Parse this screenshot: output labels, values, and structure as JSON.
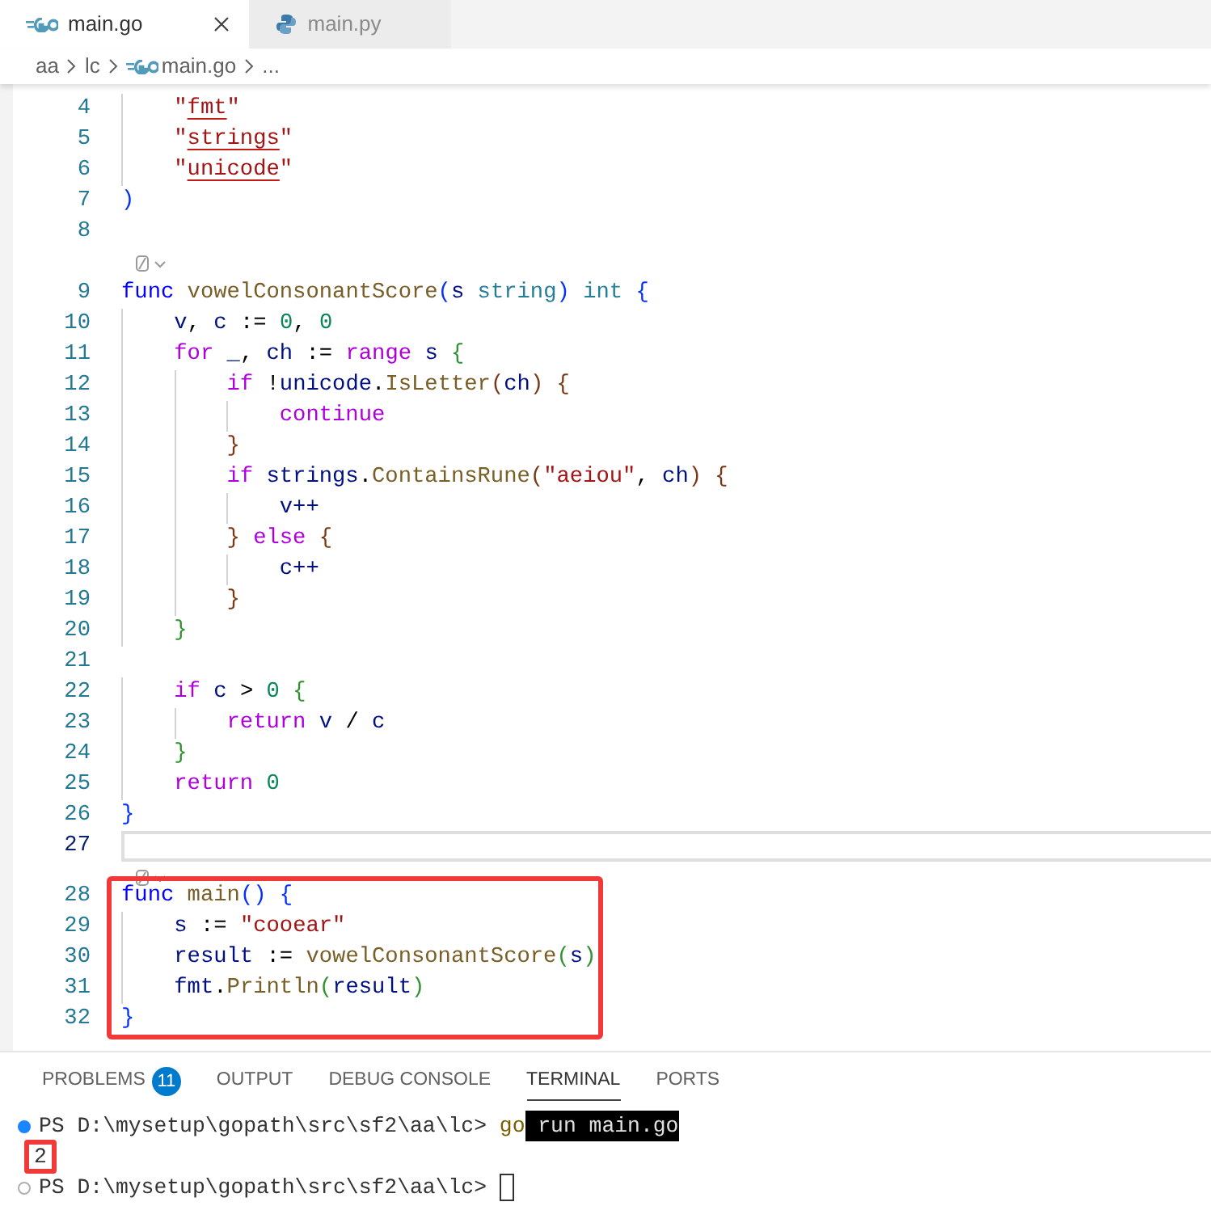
{
  "tabs": [
    {
      "label": "main.go",
      "kind": "go",
      "selected": true,
      "closable": true
    },
    {
      "label": "main.py",
      "kind": "python",
      "selected": false,
      "closable": false
    }
  ],
  "breadcrumbs": [
    {
      "label": "aa",
      "kind": "folder"
    },
    {
      "label": "lc",
      "kind": "folder"
    },
    {
      "label": "main.go",
      "kind": "go"
    },
    {
      "label": "...",
      "kind": "symbol"
    }
  ],
  "editor": {
    "lines": [
      {
        "kind": "code",
        "number": "4",
        "current": false,
        "tokens": [
          {
            "text": "    \"",
            "kind": "string"
          },
          {
            "text": "fmt",
            "kind": "string-flagged"
          },
          {
            "text": "\"",
            "kind": "string"
          }
        ]
      },
      {
        "kind": "code",
        "number": "5",
        "current": false,
        "tokens": [
          {
            "text": "    \"",
            "kind": "string"
          },
          {
            "text": "strings",
            "kind": "string-flagged"
          },
          {
            "text": "\"",
            "kind": "string"
          }
        ]
      },
      {
        "kind": "code",
        "number": "6",
        "current": false,
        "tokens": [
          {
            "text": "    \"",
            "kind": "string"
          },
          {
            "text": "unicode",
            "kind": "string-flagged"
          },
          {
            "text": "\"",
            "kind": "string"
          }
        ]
      },
      {
        "kind": "code",
        "number": "7",
        "current": false,
        "tokens": [
          {
            "text": ")",
            "kind": "bracket1"
          }
        ]
      },
      {
        "kind": "code",
        "number": "8",
        "current": false
      },
      {
        "kind": "codelens"
      },
      {
        "kind": "code",
        "number": "9",
        "current": false,
        "tokens": [
          {
            "text": "func ",
            "kind": "keyword"
          },
          {
            "text": "vowelConsonantScore",
            "kind": "function"
          },
          {
            "text": "(",
            "kind": "bracket1"
          },
          {
            "text": "s ",
            "kind": "variable"
          },
          {
            "text": "string",
            "kind": "type"
          },
          {
            "text": ") ",
            "kind": "bracket1"
          },
          {
            "text": "int ",
            "kind": "type"
          },
          {
            "text": "{",
            "kind": "bracket1"
          }
        ]
      },
      {
        "kind": "code",
        "number": "10",
        "current": false,
        "tokens": [
          {
            "text": "    v",
            "kind": "variable"
          },
          {
            "text": ", ",
            "kind": "plain"
          },
          {
            "text": "c",
            "kind": "variable"
          },
          {
            "text": " := ",
            "kind": "plain"
          },
          {
            "text": "0",
            "kind": "number"
          },
          {
            "text": ", ",
            "kind": "plain"
          },
          {
            "text": "0",
            "kind": "number"
          }
        ]
      },
      {
        "kind": "code",
        "number": "11",
        "current": false,
        "tokens": [
          {
            "text": "    for ",
            "kind": "control"
          },
          {
            "text": "_",
            "kind": "variable"
          },
          {
            "text": ", ",
            "kind": "plain"
          },
          {
            "text": "ch",
            "kind": "variable"
          },
          {
            "text": " := ",
            "kind": "plain"
          },
          {
            "text": "range ",
            "kind": "control"
          },
          {
            "text": "s ",
            "kind": "variable"
          },
          {
            "text": "{",
            "kind": "bracket2"
          }
        ]
      },
      {
        "kind": "code",
        "number": "12",
        "current": false,
        "tokens": [
          {
            "text": "        if",
            "kind": "control"
          },
          {
            "text": " !",
            "kind": "plain"
          },
          {
            "text": "unicode",
            "kind": "variable"
          },
          {
            "text": ".",
            "kind": "plain"
          },
          {
            "text": "IsLetter",
            "kind": "function"
          },
          {
            "text": "(",
            "kind": "bracket3"
          },
          {
            "text": "ch",
            "kind": "variable"
          },
          {
            "text": ") {",
            "kind": "bracket3"
          }
        ]
      },
      {
        "kind": "code",
        "number": "13",
        "current": false,
        "tokens": [
          {
            "text": "            continue",
            "kind": "control"
          }
        ]
      },
      {
        "kind": "code",
        "number": "14",
        "current": false,
        "tokens": [
          {
            "text": "        }",
            "kind": "bracket3"
          }
        ]
      },
      {
        "kind": "code",
        "number": "15",
        "current": false,
        "tokens": [
          {
            "text": "        if ",
            "kind": "control"
          },
          {
            "text": "strings",
            "kind": "variable"
          },
          {
            "text": ".",
            "kind": "plain"
          },
          {
            "text": "ContainsRune",
            "kind": "function"
          },
          {
            "text": "(",
            "kind": "bracket3"
          },
          {
            "text": "\"aeiou\"",
            "kind": "string"
          },
          {
            "text": ", ",
            "kind": "plain"
          },
          {
            "text": "ch",
            "kind": "variable"
          },
          {
            "text": ") {",
            "kind": "bracket3"
          }
        ]
      },
      {
        "kind": "code",
        "number": "16",
        "current": false,
        "tokens": [
          {
            "text": "            v++",
            "kind": "variable"
          }
        ]
      },
      {
        "kind": "code",
        "number": "17",
        "current": false,
        "tokens": [
          {
            "text": "        } ",
            "kind": "bracket3"
          },
          {
            "text": "else ",
            "kind": "control"
          },
          {
            "text": "{",
            "kind": "bracket3"
          }
        ]
      },
      {
        "kind": "code",
        "number": "18",
        "current": false,
        "tokens": [
          {
            "text": "            c++",
            "kind": "variable"
          }
        ]
      },
      {
        "kind": "code",
        "number": "19",
        "current": false,
        "tokens": [
          {
            "text": "        }",
            "kind": "bracket3"
          }
        ]
      },
      {
        "kind": "code",
        "number": "20",
        "current": false,
        "tokens": [
          {
            "text": "    }",
            "kind": "bracket2"
          }
        ]
      },
      {
        "kind": "code",
        "number": "21",
        "current": false
      },
      {
        "kind": "code",
        "number": "22",
        "current": false,
        "tokens": [
          {
            "text": "    if ",
            "kind": "control"
          },
          {
            "text": "c",
            "kind": "variable"
          },
          {
            "text": " > ",
            "kind": "plain"
          },
          {
            "text": "0 ",
            "kind": "number"
          },
          {
            "text": "{",
            "kind": "bracket2"
          }
        ]
      },
      {
        "kind": "code",
        "number": "23",
        "current": false,
        "tokens": [
          {
            "text": "        return ",
            "kind": "control"
          },
          {
            "text": "v",
            "kind": "variable"
          },
          {
            "text": " / ",
            "kind": "plain"
          },
          {
            "text": "c",
            "kind": "variable"
          }
        ]
      },
      {
        "kind": "code",
        "number": "24",
        "current": false,
        "tokens": [
          {
            "text": "    }",
            "kind": "bracket2"
          }
        ]
      },
      {
        "kind": "code",
        "number": "25",
        "current": false,
        "tokens": [
          {
            "text": "    return ",
            "kind": "control"
          },
          {
            "text": "0",
            "kind": "number"
          }
        ]
      },
      {
        "kind": "code",
        "number": "26",
        "current": false,
        "tokens": [
          {
            "text": "}",
            "kind": "bracket1"
          }
        ]
      },
      {
        "kind": "code",
        "number": "27",
        "current": true
      },
      {
        "kind": "codelens"
      },
      {
        "kind": "annotation-box",
        "lines": [
          {
            "kind": "code",
            "number": "28",
            "current": false,
            "tokens": [
              {
                "text": "func ",
                "kind": "keyword"
              },
              {
                "text": "main",
                "kind": "function"
              },
              {
                "text": "() {",
                "kind": "bracket1"
              }
            ]
          },
          {
            "kind": "code",
            "number": "29",
            "current": false,
            "tokens": [
              {
                "text": "    s",
                "kind": "variable"
              },
              {
                "text": " := ",
                "kind": "plain"
              },
              {
                "text": "\"cooear\"",
                "kind": "string"
              }
            ]
          },
          {
            "kind": "code",
            "number": "30",
            "current": false,
            "tokens": [
              {
                "text": "    result",
                "kind": "variable"
              },
              {
                "text": " := ",
                "kind": "plain"
              },
              {
                "text": "vowelConsonantScore",
                "kind": "function"
              },
              {
                "text": "(",
                "kind": "bracket2"
              },
              {
                "text": "s",
                "kind": "variable"
              },
              {
                "text": ")",
                "kind": "bracket2"
              }
            ]
          },
          {
            "kind": "code",
            "number": "31",
            "current": false,
            "tokens": [
              {
                "text": "    fmt",
                "kind": "variable"
              },
              {
                "text": ".",
                "kind": "plain"
              },
              {
                "text": "Println",
                "kind": "function"
              },
              {
                "text": "(",
                "kind": "bracket2"
              },
              {
                "text": "result",
                "kind": "variable"
              },
              {
                "text": ")",
                "kind": "bracket2"
              }
            ]
          },
          {
            "kind": "code",
            "number": "32",
            "current": false,
            "tokens": [
              {
                "text": "}",
                "kind": "bracket1"
              }
            ]
          }
        ]
      }
    ]
  },
  "panel": {
    "tabs": [
      {
        "label": "PROBLEMS",
        "badge": "11",
        "selected": false
      },
      {
        "label": "OUTPUT",
        "selected": false
      },
      {
        "label": "DEBUG CONSOLE",
        "selected": false
      },
      {
        "label": "TERMINAL",
        "selected": true
      },
      {
        "label": "PORTS",
        "selected": false
      }
    ],
    "terminal": [
      {
        "kind": "command",
        "highlighted": false,
        "cursor": false,
        "segments": [
          {
            "text": "PS D:\\mysetup\\gopath\\src\\sf2\\aa\\lc> ",
            "kind": "prompt"
          },
          {
            "text": "go",
            "kind": "command"
          },
          {
            "text": " run main.go",
            "kind": "selection"
          }
        ]
      },
      {
        "kind": "output",
        "highlighted": true,
        "cursor": false,
        "segments": [
          {
            "text": "2",
            "kind": "output"
          }
        ]
      },
      {
        "kind": "prompt",
        "highlighted": false,
        "cursor": true,
        "segments": [
          {
            "text": "PS D:\\mysetup\\gopath\\src\\sf2\\aa\\lc> ",
            "kind": "prompt"
          }
        ]
      }
    ]
  }
}
